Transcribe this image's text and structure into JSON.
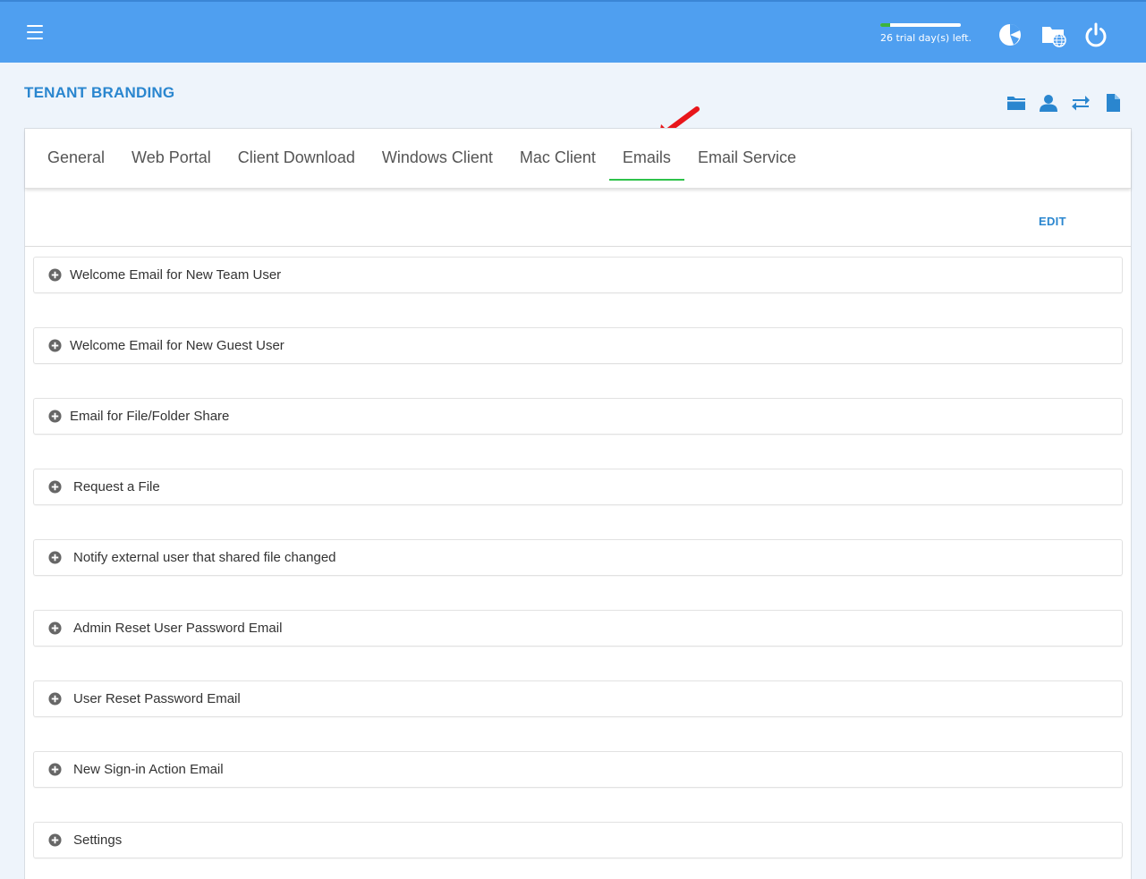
{
  "header": {
    "trial_text": "26 trial day(s) left.",
    "trial_progress": 0.12,
    "icons": [
      "dashboard-icon",
      "web-folder-icon",
      "power-icon"
    ]
  },
  "page": {
    "title": "TENANT BRANDING",
    "actions": [
      "folder-icon",
      "user-icon",
      "transfer-icon",
      "document-icon"
    ]
  },
  "tabs": [
    {
      "label": "General"
    },
    {
      "label": "Web Portal"
    },
    {
      "label": "Client Download"
    },
    {
      "label": "Windows Client"
    },
    {
      "label": "Mac Client"
    },
    {
      "label": "Emails",
      "active": true
    },
    {
      "label": "Email Service"
    }
  ],
  "toolbar": {
    "edit_label": "EDIT"
  },
  "sections": [
    {
      "label": "Welcome Email for New Team User"
    },
    {
      "label": "Welcome Email for New Guest User"
    },
    {
      "label": "Email for File/Folder Share"
    },
    {
      "label": "Request a File"
    },
    {
      "label": "Notify external user that shared file changed"
    },
    {
      "label": "Admin Reset User Password Email"
    },
    {
      "label": "User Reset Password Email"
    },
    {
      "label": "New Sign-in Action Email"
    },
    {
      "label": "Settings"
    }
  ],
  "colors": {
    "topbar": "#4f9ff0",
    "accent": "#2a86cf",
    "active_tab_underline": "#2ec24a",
    "arrow": "#e8161b"
  }
}
